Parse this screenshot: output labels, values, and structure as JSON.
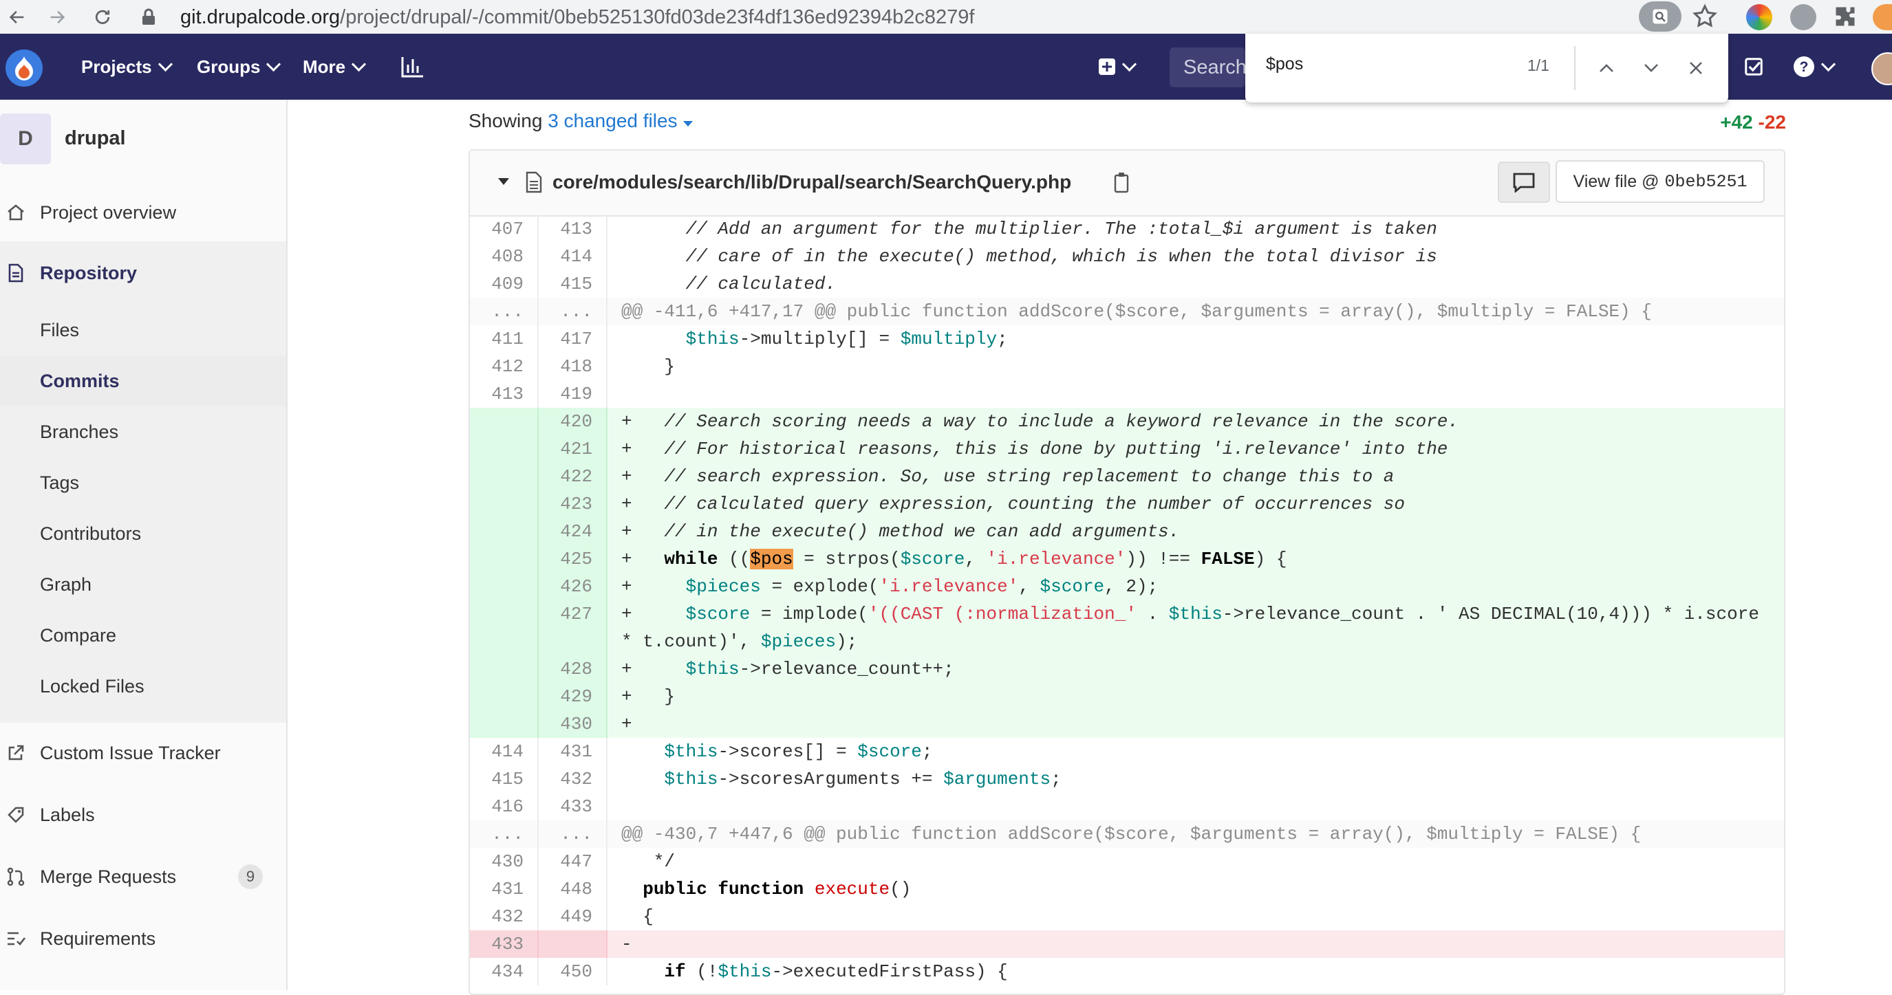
{
  "browser": {
    "url_domain": "git.drupalcode.org",
    "url_path": "/project/drupal/-/commit/0beb525130fd03de23f4df136ed92394b2c8279f"
  },
  "header": {
    "nav": [
      "Projects",
      "Groups",
      "More"
    ],
    "search_placeholder": "Search"
  },
  "findbar": {
    "query": "$pos",
    "count": "1/1"
  },
  "sidebar": {
    "project_initial": "D",
    "project_name": "drupal",
    "overview": "Project overview",
    "repository": "Repository",
    "sub_items": [
      "Files",
      "Commits",
      "Branches",
      "Tags",
      "Contributors",
      "Graph",
      "Compare",
      "Locked Files"
    ],
    "custom_tracker": "Custom Issue Tracker",
    "labels": "Labels",
    "merge_requests": "Merge Requests",
    "merge_requests_count": "9",
    "requirements": "Requirements"
  },
  "main": {
    "showing_prefix": "Showing",
    "changed_files": "3 changed files",
    "additions": "+42",
    "deletions": "-22",
    "file_path": "core/modules/search/lib/Drupal/search/SearchQuery.php",
    "view_file_label": "View file @",
    "view_file_sha": "0beb5251"
  },
  "diff": [
    {
      "type": "ctx",
      "old": "407",
      "new": "413",
      "code": "      // Add an argument for the multiplier. The :total_$i argument is taken"
    },
    {
      "type": "ctx",
      "old": "408",
      "new": "414",
      "code": "      // care of in the execute() method, which is when the total divisor is"
    },
    {
      "type": "ctx",
      "old": "409",
      "new": "415",
      "code": "      // calculated."
    },
    {
      "type": "hunk",
      "old": "...",
      "new": "...",
      "code": "@@ -411,6 +417,17 @@ public function addScore($score, $arguments = array(), $multiply = FALSE) {"
    },
    {
      "type": "ctx",
      "old": "411",
      "new": "417",
      "code": "      $this->multiply[] = $multiply;"
    },
    {
      "type": "ctx",
      "old": "412",
      "new": "418",
      "code": "    }"
    },
    {
      "type": "ctx",
      "old": "413",
      "new": "419",
      "code": ""
    },
    {
      "type": "add",
      "old": "",
      "new": "420",
      "code": "+   // Search scoring needs a way to include a keyword relevance in the score."
    },
    {
      "type": "add",
      "old": "",
      "new": "421",
      "code": "+   // For historical reasons, this is done by putting 'i.relevance' into the"
    },
    {
      "type": "add",
      "old": "",
      "new": "422",
      "code": "+   // search expression. So, use string replacement to change this to a"
    },
    {
      "type": "add",
      "old": "",
      "new": "423",
      "code": "+   // calculated query expression, counting the number of occurrences so"
    },
    {
      "type": "add",
      "old": "",
      "new": "424",
      "code": "+   // in the execute() method we can add arguments."
    },
    {
      "type": "add",
      "old": "",
      "new": "425",
      "code": "+   while (($pos = strpos($score, 'i.relevance')) !== FALSE) {"
    },
    {
      "type": "add",
      "old": "",
      "new": "426",
      "code": "+     $pieces = explode('i.relevance', $score, 2);"
    },
    {
      "type": "add",
      "old": "",
      "new": "427",
      "code": "+     $score = implode('((CAST (:normalization_' . $this->relevance_count . ' AS DECIMAL(10,4))) * i.score\n* t.count)', $pieces);"
    },
    {
      "type": "add",
      "old": "",
      "new": "428",
      "code": "+     $this->relevance_count++;"
    },
    {
      "type": "add",
      "old": "",
      "new": "429",
      "code": "+   }"
    },
    {
      "type": "add",
      "old": "",
      "new": "430",
      "code": "+"
    },
    {
      "type": "ctx",
      "old": "414",
      "new": "431",
      "code": "    $this->scores[] = $score;"
    },
    {
      "type": "ctx",
      "old": "415",
      "new": "432",
      "code": "    $this->scoresArguments += $arguments;"
    },
    {
      "type": "ctx",
      "old": "416",
      "new": "433",
      "code": ""
    },
    {
      "type": "hunk",
      "old": "...",
      "new": "...",
      "code": "@@ -430,7 +447,6 @@ public function addScore($score, $arguments = array(), $multiply = FALSE) {"
    },
    {
      "type": "ctx",
      "old": "430",
      "new": "447",
      "code": "   */"
    },
    {
      "type": "ctx",
      "old": "431",
      "new": "448",
      "code": "  public function execute()"
    },
    {
      "type": "ctx",
      "old": "432",
      "new": "449",
      "code": "  {"
    },
    {
      "type": "del",
      "old": "433",
      "new": "",
      "code": "-"
    },
    {
      "type": "ctx",
      "old": "434",
      "new": "450",
      "code": "    if (!$this->executedFirstPass) {"
    }
  ]
}
